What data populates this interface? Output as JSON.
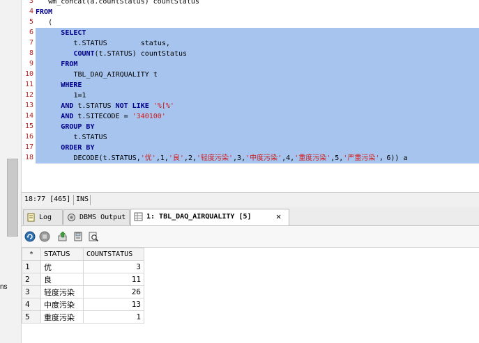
{
  "left_panel": {
    "stub_text": "ns"
  },
  "editor": {
    "lines": [
      {
        "n": "3",
        "indent": 3,
        "tokens": [
          {
            "t": "wm_concat(a.countStatus) countStatus"
          }
        ]
      },
      {
        "n": "4",
        "indent": 0,
        "tokens": [
          {
            "t": "FROM",
            "c": "kw"
          }
        ]
      },
      {
        "n": "5",
        "indent": 3,
        "tokens": [
          {
            "t": "("
          }
        ]
      },
      {
        "n": "6",
        "indent": 6,
        "sel": true,
        "tokens": [
          {
            "t": "SELECT",
            "c": "kw"
          }
        ]
      },
      {
        "n": "7",
        "indent": 9,
        "sel": true,
        "tokens": [
          {
            "t": "t.STATUS        status,"
          }
        ]
      },
      {
        "n": "8",
        "indent": 9,
        "sel": true,
        "tokens": [
          {
            "t": "COUNT",
            "c": "kw"
          },
          {
            "t": "(t.STATUS) countStatus"
          }
        ]
      },
      {
        "n": "9",
        "indent": 6,
        "sel": true,
        "tokens": [
          {
            "t": "FROM",
            "c": "kw"
          }
        ]
      },
      {
        "n": "10",
        "indent": 9,
        "sel": true,
        "tokens": [
          {
            "t": "TBL_DAQ_AIRQUALITY t"
          }
        ]
      },
      {
        "n": "11",
        "indent": 6,
        "sel": true,
        "tokens": [
          {
            "t": "WHERE",
            "c": "kw"
          }
        ]
      },
      {
        "n": "12",
        "indent": 9,
        "sel": true,
        "tokens": [
          {
            "t": "1=1"
          }
        ]
      },
      {
        "n": "13",
        "indent": 6,
        "sel": true,
        "tokens": [
          {
            "t": "AND",
            "c": "kw"
          },
          {
            "t": " t.STATUS "
          },
          {
            "t": "NOT LIKE",
            "c": "kw"
          },
          {
            "t": " "
          },
          {
            "t": "'%[%'",
            "c": "str"
          }
        ]
      },
      {
        "n": "14",
        "indent": 6,
        "sel": true,
        "tokens": [
          {
            "t": "AND",
            "c": "kw"
          },
          {
            "t": " t.SITECODE = "
          },
          {
            "t": "'340100'",
            "c": "str"
          }
        ]
      },
      {
        "n": "15",
        "indent": 6,
        "sel": true,
        "tokens": [
          {
            "t": "GROUP BY",
            "c": "kw"
          }
        ]
      },
      {
        "n": "16",
        "indent": 9,
        "sel": true,
        "tokens": [
          {
            "t": "t.STATUS"
          }
        ]
      },
      {
        "n": "17",
        "indent": 6,
        "sel": true,
        "tokens": [
          {
            "t": "ORDER BY",
            "c": "kw"
          }
        ]
      },
      {
        "n": "18",
        "indent": 9,
        "sel": true,
        "tokens": [
          {
            "t": "DECODE(t.STATUS,"
          },
          {
            "t": "'优'",
            "c": "str"
          },
          {
            "t": ",1,"
          },
          {
            "t": "'良'",
            "c": "str"
          },
          {
            "t": ",2,"
          },
          {
            "t": "'轻度污染'",
            "c": "str"
          },
          {
            "t": ",3,"
          },
          {
            "t": "'中度污染'",
            "c": "str"
          },
          {
            "t": ",4,"
          },
          {
            "t": "'重度污染'",
            "c": "str"
          },
          {
            "t": ",5,"
          },
          {
            "t": "'严重污染'",
            "c": "str"
          },
          {
            "t": "，6)) a"
          }
        ]
      }
    ]
  },
  "statusbar": {
    "position": "18:77 [465]",
    "mode": "INS"
  },
  "tabs": [
    {
      "label": "Log",
      "icon": "log-icon",
      "active": false
    },
    {
      "label": "DBMS Output",
      "icon": "dbms-output-icon",
      "active": false
    },
    {
      "label": "1: TBL_DAQ_AIRQUALITY [5]",
      "icon": "table-grid-icon",
      "active": true,
      "close": "✕"
    }
  ],
  "toolbar": {
    "buttons": [
      {
        "name": "refresh-icon"
      },
      {
        "name": "stop-icon"
      },
      {
        "name": "export-icon"
      },
      {
        "name": "save-icon"
      },
      {
        "name": "find-icon"
      }
    ]
  },
  "results": {
    "corner": "*",
    "columns": [
      "STATUS",
      "COUNTSTATUS"
    ],
    "rows": [
      {
        "n": "1",
        "status": "优",
        "count": "3"
      },
      {
        "n": "2",
        "status": "良",
        "count": "11"
      },
      {
        "n": "3",
        "status": "轻度污染",
        "count": "26"
      },
      {
        "n": "4",
        "status": "中度污染",
        "count": "13"
      },
      {
        "n": "5",
        "status": "重度污染",
        "count": "1"
      }
    ]
  },
  "colors": {
    "selection": "#a6c4ee",
    "keyword": "#00008b",
    "string": "#d21a1a",
    "line_number": "#b22222"
  }
}
